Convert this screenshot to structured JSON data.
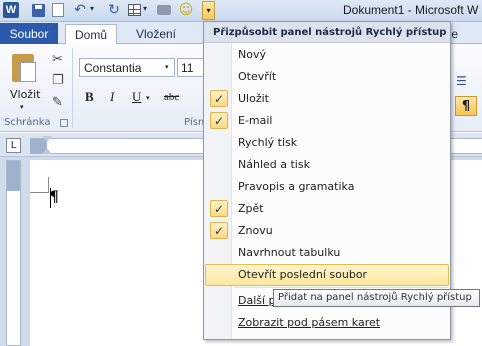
{
  "titlebar": {
    "app_icon_letter": "W",
    "window_title": "Dokument1 - Microsoft W",
    "qat_icons": [
      "word-logo",
      "save-icon",
      "form-icon",
      "undo-icon",
      "redo-icon",
      "table-icon",
      "print-icon",
      "smiley-icon",
      "qat-dropdown-icon"
    ],
    "dropdown_glyph": "▾"
  },
  "tabs": {
    "file": "Soubor",
    "home": "Domů",
    "insert": "Vložení",
    "partial_right": "ence"
  },
  "ribbon": {
    "paste_label": "Vložit",
    "clipboard_group": "Schránka",
    "font_name": "Constantia",
    "font_size": "11",
    "font_group_partial": "Písm",
    "bold": "B",
    "italic": "I",
    "underline": "U",
    "strikethrough": "abc"
  },
  "document": {
    "pilcrow": "¶"
  },
  "menu": {
    "title": "Přizpůsobit panel nástrojů Rychlý přístup",
    "items": [
      {
        "label": "Nový",
        "checked": false
      },
      {
        "label": "Otevřít",
        "checked": false
      },
      {
        "label": "Uložit",
        "checked": true
      },
      {
        "label": "E-mail",
        "checked": true
      },
      {
        "label": "Rychlý tisk",
        "checked": false
      },
      {
        "label": "Náhled a tisk",
        "checked": false
      },
      {
        "label": "Pravopis a gramatika",
        "checked": false
      },
      {
        "label": "Zpět",
        "checked": true
      },
      {
        "label": "Znovu",
        "checked": true
      },
      {
        "label": "Navrhnout tabulku",
        "checked": false
      },
      {
        "label": "Otevřít poslední soubor",
        "checked": false,
        "highlighted": true
      }
    ],
    "more_commands": "Další p",
    "show_below": "Zobrazit pod pásem karet",
    "check_glyph": "✓"
  },
  "tooltip": {
    "text": "Přidat na panel nástrojů Rychlý přístup"
  },
  "colors": {
    "file_tab": "#2a5aa9",
    "highlight": "#fde89e",
    "checkbox": "#fbd983"
  }
}
